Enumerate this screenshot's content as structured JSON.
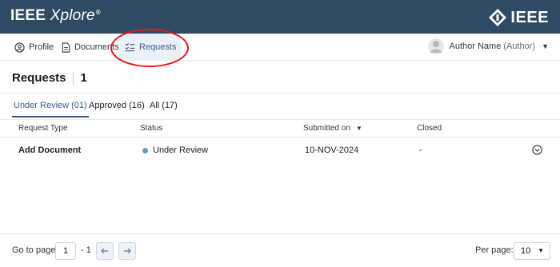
{
  "header": {
    "brand_main": "IEEE",
    "brand_sub": "Xplore",
    "brand_reg": "®",
    "org_logo_text": "IEEE",
    "bg_color": "#2f4a63"
  },
  "nav": {
    "items": [
      {
        "label": "Profile",
        "icon": "user-circle-icon"
      },
      {
        "label": "Documents",
        "icon": "document-icon"
      },
      {
        "label": "Requests",
        "icon": "checklist-icon",
        "active": true
      }
    ],
    "user": {
      "name": "Author Name",
      "role": "(Author)"
    }
  },
  "page": {
    "title": "Requests",
    "count": "1"
  },
  "tabs": [
    {
      "label": "Under Review (01)",
      "active": true
    },
    {
      "label": "Approved (16)"
    },
    {
      "label": "All (17)"
    }
  ],
  "table": {
    "columns": [
      "Request Type",
      "Status",
      "Submitted on",
      "Closed"
    ],
    "rows": [
      {
        "type": "Add Document",
        "status": "Under Review",
        "status_color": "#5aa0d8",
        "submitted": "10-NOV-2024",
        "closed": "-"
      }
    ]
  },
  "pagination": {
    "goto_label": "Go to page",
    "current_page": "1",
    "total_text": "- 1",
    "per_page_label": "Per page:",
    "per_page_value": "10"
  },
  "annotation_color": "#e01a1a"
}
